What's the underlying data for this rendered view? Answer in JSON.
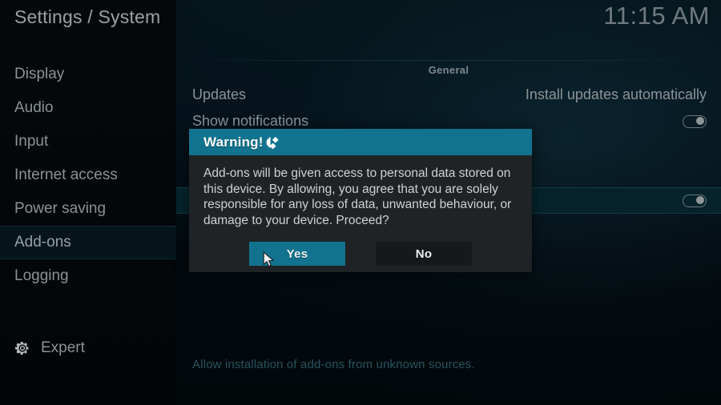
{
  "header": {
    "breadcrumb": "Settings / System",
    "clock": "11:15 AM"
  },
  "sidebar": {
    "items": [
      {
        "label": "Display",
        "selected": false
      },
      {
        "label": "Audio",
        "selected": false
      },
      {
        "label": "Input",
        "selected": false
      },
      {
        "label": "Internet access",
        "selected": false
      },
      {
        "label": "Power saving",
        "selected": false
      },
      {
        "label": "Add-ons",
        "selected": true
      },
      {
        "label": "Logging",
        "selected": false
      }
    ],
    "level": {
      "label": "Expert",
      "icon": "gear-icon"
    }
  },
  "main": {
    "group_header": "General",
    "rows": [
      {
        "label": "Updates",
        "value": "Install updates automatically",
        "control": "text"
      },
      {
        "label": "Show notifications",
        "value": "",
        "control": "toggle",
        "toggle_on": true
      },
      {
        "label": "",
        "value": "",
        "control": "toggle",
        "toggle_on": true,
        "highlighted": true
      }
    ],
    "hint": "Allow installation of add-ons from unknown sources."
  },
  "dialog": {
    "title": "Warning!",
    "logo_icon": "kodi-logo-icon",
    "message": "Add-ons will be given access to personal data stored on this device. By allowing, you agree that you are solely responsible for any loss of data, unwanted behaviour, or damage to your device. Proceed?",
    "buttons": [
      {
        "label": "Yes",
        "focused": true
      },
      {
        "label": "No",
        "focused": false
      }
    ]
  },
  "colors": {
    "accent_teal": "#12738f",
    "dialog_bg": "#1f2325",
    "button_inactive": "#15191b",
    "highlight_row": "#06232c",
    "sidebar_selected": "#06151c",
    "hint_text": "#26545f"
  }
}
